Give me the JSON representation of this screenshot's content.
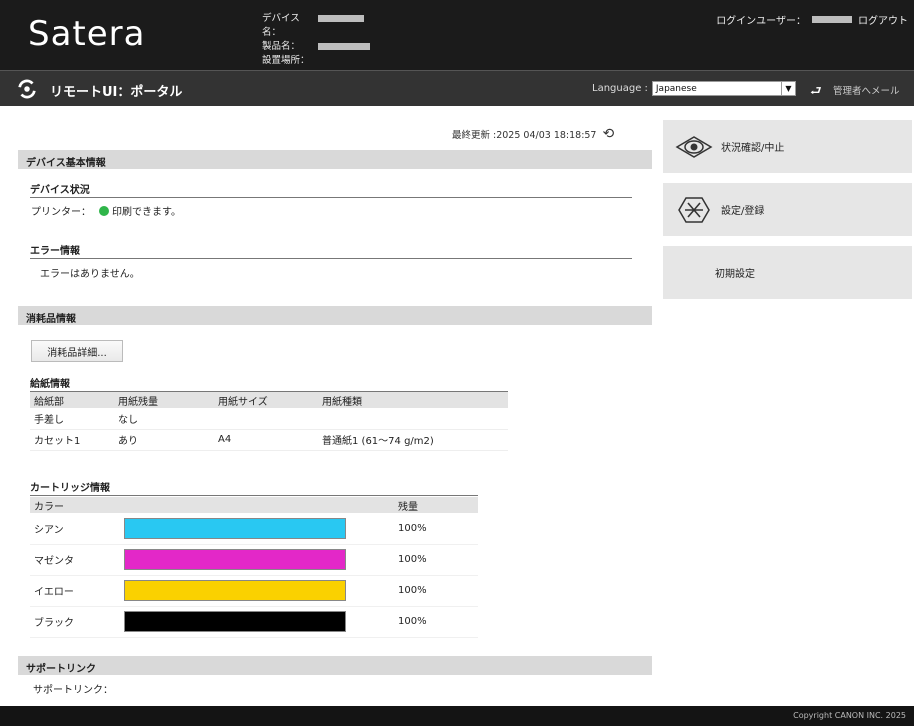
{
  "header": {
    "logo": "Satera",
    "device_name_label": "デバイス名：",
    "product_name_label": "製品名：",
    "location_label": "設置場所：",
    "login_user_label": "ログインユーザー：",
    "logout_label": "ログアウト"
  },
  "subbar": {
    "title": "リモートUI：ポータル",
    "language_label": "Language :",
    "language_value": "Japanese",
    "mail_link": "管理者へメール"
  },
  "last_update": "最終更新 :2025 04/03 18:18:57",
  "device_info": {
    "section_title": "デバイス基本情報",
    "status_title": "デバイス状況",
    "printer_label": "プリンター：",
    "printer_status": "印刷できます。",
    "status_color": "#2fb54a",
    "error_title": "エラー情報",
    "error_text": "エラーはありません。"
  },
  "consumables": {
    "section_title": "消耗品情報",
    "detail_button": "消耗品詳細...",
    "paper_title": "給紙情報",
    "paper_headers": [
      "給紙部",
      "用紙残量",
      "用紙サイズ",
      "用紙種類"
    ],
    "paper_rows": [
      [
        "手差し",
        "なし",
        "",
        ""
      ],
      [
        "カセット1",
        "あり",
        "A4",
        "普通紙1 (61～74 g/m2)"
      ]
    ],
    "cartridge_title": "カートリッジ情報",
    "cartridge_headers": [
      "カラー",
      "",
      "残量"
    ],
    "cartridges": [
      {
        "name": "シアン",
        "color": "#29c8f2",
        "level": "100%"
      },
      {
        "name": "マゼンタ",
        "color": "#e328c8",
        "level": "100%"
      },
      {
        "name": "イエロー",
        "color": "#fad100",
        "level": "100%"
      },
      {
        "name": "ブラック",
        "color": "#000000",
        "level": "100%"
      }
    ]
  },
  "support": {
    "section_title": "サポートリンク",
    "link_label": "サポートリンク："
  },
  "side_menu": [
    {
      "label": "状況確認/中止",
      "icon": "eye-icon"
    },
    {
      "label": "設定/登録",
      "icon": "settings-asterisk-icon"
    },
    {
      "label": "初期設定",
      "icon": ""
    }
  ],
  "footer": "Copyright CANON INC. 2025"
}
